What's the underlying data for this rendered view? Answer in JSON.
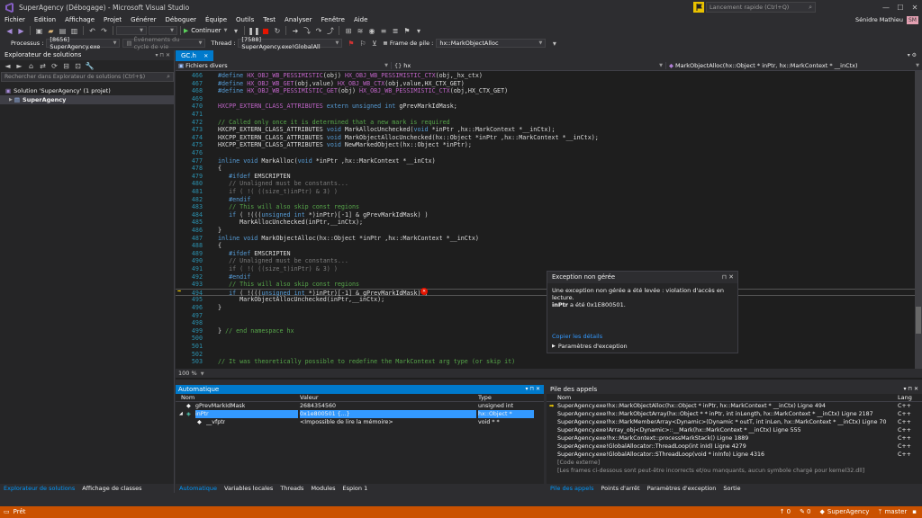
{
  "window": {
    "title": "SuperAgency (Débogage) - Microsoft Visual Studio",
    "quick_launch_placeholder": "Lancement rapide (Ctrl+Q)",
    "user_name": "Sénidre Mathieu",
    "user_initials": "SM"
  },
  "menu": [
    "Fichier",
    "Edition",
    "Affichage",
    "Projet",
    "Générer",
    "Déboguer",
    "Équipe",
    "Outils",
    "Test",
    "Analyser",
    "Fenêtre",
    "Aide"
  ],
  "toolbar": {
    "continue_label": "Continuer"
  },
  "debug_bar": {
    "process_label": "Processus :",
    "process_value": "[8656] SuperAgency.exe",
    "lifecycle_label": "Événements du cycle de vie",
    "thread_label": "Thread :",
    "thread_value": "[7588] SuperAgency.exe!GlobalAll",
    "frame_label": "Frame de pile :",
    "frame_value": "hx::MarkObjectAlloc"
  },
  "solution_explorer": {
    "title": "Explorateur de solutions",
    "search_placeholder": "Rechercher dans Explorateur de solutions (Ctrl+$)",
    "solution_label": "Solution 'SuperAgency' (1 projet)",
    "project_label": "SuperAgency",
    "tabs": [
      "Explorateur de solutions",
      "Affichage de classes"
    ]
  },
  "editor": {
    "tab_label": "GC.h",
    "nav_scope": "Fichiers divers",
    "nav_ns": "hx",
    "nav_member": "MarkObjectAlloc(hx::Object * inPtr, hx::MarkContext * __inCtx)",
    "zoom": "100 %",
    "lines": [
      {
        "n": "466",
        "html": "<span class='kw'>#define</span> <span class='mac'>HX_OBJ_WB_PESSIMISTIC</span>(obj) <span class='mac'>HX_OBJ_WB_PESSIMISTIC_CTX</span>(obj,_hx_ctx)"
      },
      {
        "n": "467",
        "html": "<span class='kw'>#define</span> <span class='mac'>HX_OBJ_WB_GET</span>(obj,value) <span class='mac'>HX_OBJ_WB_CTX</span>(obj,value,HX_CTX_GET)"
      },
      {
        "n": "468",
        "html": "<span class='kw'>#define</span> <span class='mac'>HX_OBJ_WB_PESSIMISTIC_GET</span>(obj) <span class='mac'>HX_OBJ_WB_PESSIMISTIC_CTX</span>(obj,HX_CTX_GET)"
      },
      {
        "n": "469",
        "html": ""
      },
      {
        "n": "470",
        "html": "<span class='mac'>HXCPP_EXTERN_CLASS_ATTRIBUTES</span> <span class='kw'>extern</span> <span class='kw'>unsigned</span> <span class='kw'>int</span> gPrevMarkIdMask;"
      },
      {
        "n": "471",
        "html": ""
      },
      {
        "n": "472",
        "html": "<span class='cm'>// Called only once it is determined that a new mark is required</span>"
      },
      {
        "n": "473",
        "html": "HXCPP_EXTERN_CLASS_ATTRIBUTES <span class='kw'>void</span> MarkAllocUnchecked(<span class='kw'>void</span> *inPtr ,hx::MarkContext *__inCtx);"
      },
      {
        "n": "474",
        "html": "HXCPP_EXTERN_CLASS_ATTRIBUTES <span class='kw'>void</span> MarkObjectAllocUnchecked(hx::Object *inPtr ,hx::MarkContext *__inCtx);"
      },
      {
        "n": "475",
        "html": "HXCPP_EXTERN_CLASS_ATTRIBUTES <span class='kw'>void</span> NewMarkedObject(hx::Object *inPtr);"
      },
      {
        "n": "476",
        "html": ""
      },
      {
        "n": "477",
        "html": "<span class='kw'>inline</span> <span class='kw'>void</span> MarkAlloc(<span class='kw'>void</span> *inPtr ,hx::MarkContext *__inCtx)"
      },
      {
        "n": "478",
        "html": "{"
      },
      {
        "n": "479",
        "html": "   <span class='kw'>#ifdef</span> EMSCRIPTEN"
      },
      {
        "n": "480",
        "html": "   <span class='cm dim'>// Unaligned must be constants...</span>"
      },
      {
        "n": "481",
        "html": "   <span class='dim'>if ( !( ((size_t)inPtr) &amp; 3) )</span>"
      },
      {
        "n": "482",
        "html": "   <span class='kw'>#endif</span>"
      },
      {
        "n": "483",
        "html": "   <span class='cm'>// This will also skip const regions</span>"
      },
      {
        "n": "484",
        "html": "   <span class='kw'>if</span> ( !(((<span class='kw'>unsigned</span> <span class='kw'>int</span> *)inPtr)[-1] &amp; gPrevMarkIdMask) )"
      },
      {
        "n": "485",
        "html": "      MarkAllocUnchecked(inPtr,__inCtx);"
      },
      {
        "n": "486",
        "html": "}"
      },
      {
        "n": "487",
        "html": "<span class='kw'>inline</span> <span class='kw'>void</span> MarkObjectAlloc(hx::Object *inPtr ,hx::MarkContext *__inCtx)"
      },
      {
        "n": "488",
        "html": "{"
      },
      {
        "n": "489",
        "html": "   <span class='kw'>#ifdef</span> EMSCRIPTEN"
      },
      {
        "n": "490",
        "html": "   <span class='cm dim'>// Unaligned must be constants...</span>"
      },
      {
        "n": "491",
        "html": "   <span class='dim'>if ( !( ((size_t)inPtr) &amp; 3) )</span>"
      },
      {
        "n": "492",
        "html": "   <span class='kw'>#endif</span>"
      },
      {
        "n": "493",
        "html": "   <span class='cm'>// This will also skip const regions</span>"
      },
      {
        "n": "494",
        "html": "   <span class='kw'>if</span> ( !(((<span class='kw'>unsigned</span> <span class='kw'>int</span> *)inPtr)[-1] &amp; gPrevMarkIdMask) )"
      },
      {
        "n": "495",
        "html": "      MarkObjectAllocUnchecked(inPtr,__inCtx);"
      },
      {
        "n": "496",
        "html": "}"
      },
      {
        "n": "497",
        "html": ""
      },
      {
        "n": "498",
        "html": ""
      },
      {
        "n": "499",
        "html": "} <span class='cm'>// end namespace hx</span>"
      },
      {
        "n": "500",
        "html": ""
      },
      {
        "n": "501",
        "html": ""
      },
      {
        "n": "502",
        "html": ""
      },
      {
        "n": "503",
        "html": "<span class='cm'>// It was theoretically possible to redefine the MarkContext arg type (or skip it)</span>"
      }
    ]
  },
  "exception": {
    "title": "Exception non gérée",
    "message": "Une exception non gérée a été levée : violation d'accès en lecture.",
    "detail_var": "inPtr",
    "detail_rest": " a été 0x1E800501.",
    "link_details": "Copier les détails",
    "settings_label": "Paramètres d'exception"
  },
  "autos": {
    "title": "Automatique",
    "headers": [
      "Nom",
      "Valeur",
      "Type"
    ],
    "rows": [
      {
        "name": "gPrevMarkIdMask",
        "value": "2684354560",
        "type": "unsigned int"
      },
      {
        "name": "inPtr",
        "value": "0x1e800501 {...}",
        "type": "hx::Object *"
      },
      {
        "name": "__vfptr",
        "value": "<Impossible de lire la mémoire>",
        "type": "void * *"
      }
    ],
    "tabs": [
      "Automatique",
      "Variables locales",
      "Threads",
      "Modules",
      "Espion 1"
    ]
  },
  "callstack": {
    "title": "Pile des appels",
    "headers": [
      "Nom",
      "Lang"
    ],
    "rows": [
      {
        "name": "SuperAgency.exe!hx::MarkObjectAlloc(hx::Object * inPtr, hx::MarkContext * __inCtx) Ligne 494",
        "lang": "C++"
      },
      {
        "name": "SuperAgency.exe!hx::MarkObjectArray(hx::Object * * inPtr, int inLength, hx::MarkContext * __inCtx) Ligne 2187",
        "lang": "C++"
      },
      {
        "name": "SuperAgency.exe!hx::MarkMemberArray<Dynamic>(Dynamic * outT, int inLen, hx::MarkContext * __inCtx) Ligne 70",
        "lang": "C++"
      },
      {
        "name": "SuperAgency.exe!Array_obj<Dynamic>::__Mark(hx::MarkContext * __inCtx) Ligne 555",
        "lang": "C++"
      },
      {
        "name": "SuperAgency.exe!hx::MarkContext::processMarkStack() Ligne 1889",
        "lang": "C++"
      },
      {
        "name": "SuperAgency.exe!GlobalAllocator::ThreadLoop(int inId) Ligne 4279",
        "lang": "C++"
      },
      {
        "name": "SuperAgency.exe!GlobalAllocator::SThreadLoop(void * inInfo) Ligne 4316",
        "lang": "C++"
      },
      {
        "name": "[Code externe]",
        "lang": ""
      },
      {
        "name": "[Les frames ci-dessous sont peut-être incorrects et/ou manquants, aucun symbole chargé pour kernel32.dll]",
        "lang": ""
      }
    ],
    "tabs": [
      "Pile des appels",
      "Points d'arrêt",
      "Paramètres d'exception",
      "Sortie"
    ]
  },
  "status": {
    "left": "Prêt",
    "up_count": "0",
    "pencil_count": "0",
    "project": "SuperAgency",
    "branch": "master"
  },
  "colors": {
    "accent": "#007acc",
    "status_debug": "#ca5100",
    "bg": "#2d2d30"
  }
}
